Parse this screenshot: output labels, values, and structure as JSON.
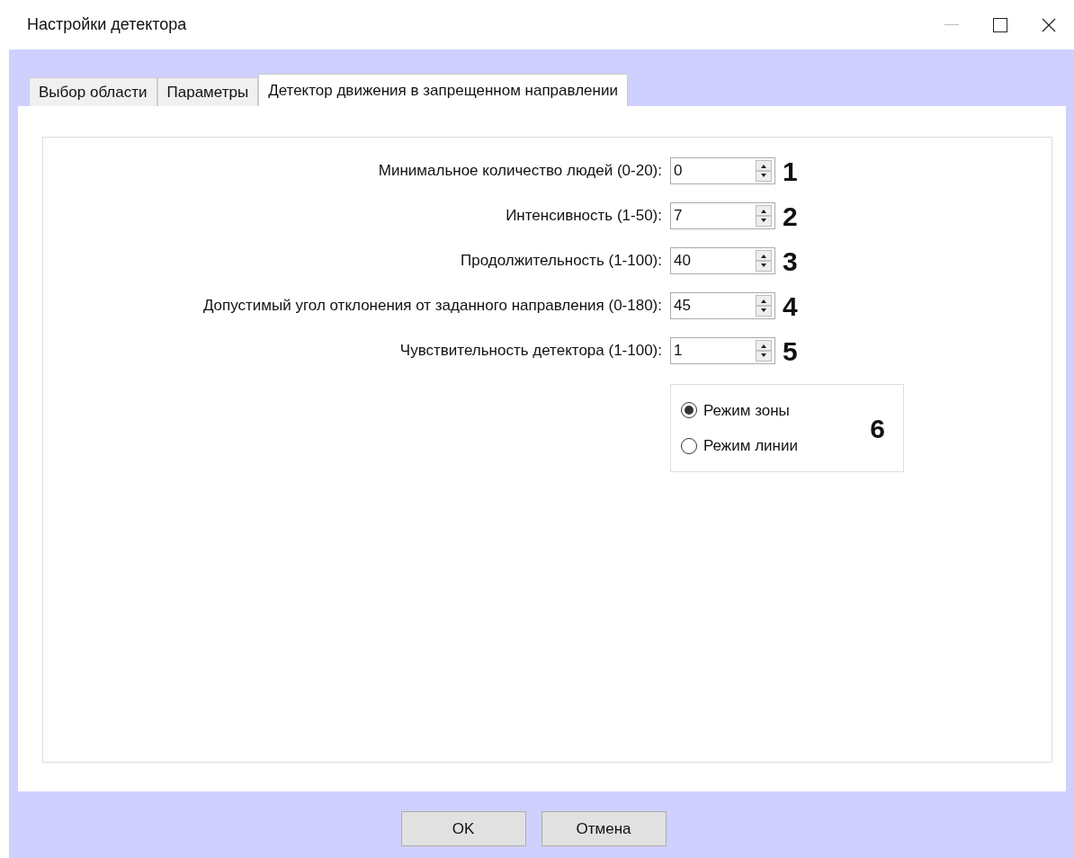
{
  "window": {
    "title": "Настройки детектора"
  },
  "tabs": [
    {
      "label": "Выбор области",
      "selected": false
    },
    {
      "label": "Параметры",
      "selected": false
    },
    {
      "label": "Детектор движения в запрещенном направлении",
      "selected": true
    }
  ],
  "fields": [
    {
      "label": "Минимальное количество людей (0-20):",
      "value": "0",
      "callout": "1"
    },
    {
      "label": "Интенсивность (1-50):",
      "value": "7",
      "callout": "2"
    },
    {
      "label": "Продолжительность (1-100):",
      "value": "40",
      "callout": "3"
    },
    {
      "label": "Допустимый угол отклонения от заданного направления (0-180):",
      "value": "45",
      "callout": "4"
    },
    {
      "label": "Чувствительность детектора (1-100):",
      "value": "1",
      "callout": "5"
    }
  ],
  "mode": {
    "callout": "6",
    "options": [
      {
        "label": "Режим зоны",
        "selected": true
      },
      {
        "label": "Режим линии",
        "selected": false
      }
    ]
  },
  "buttons": [
    "OK",
    "Отмена"
  ]
}
